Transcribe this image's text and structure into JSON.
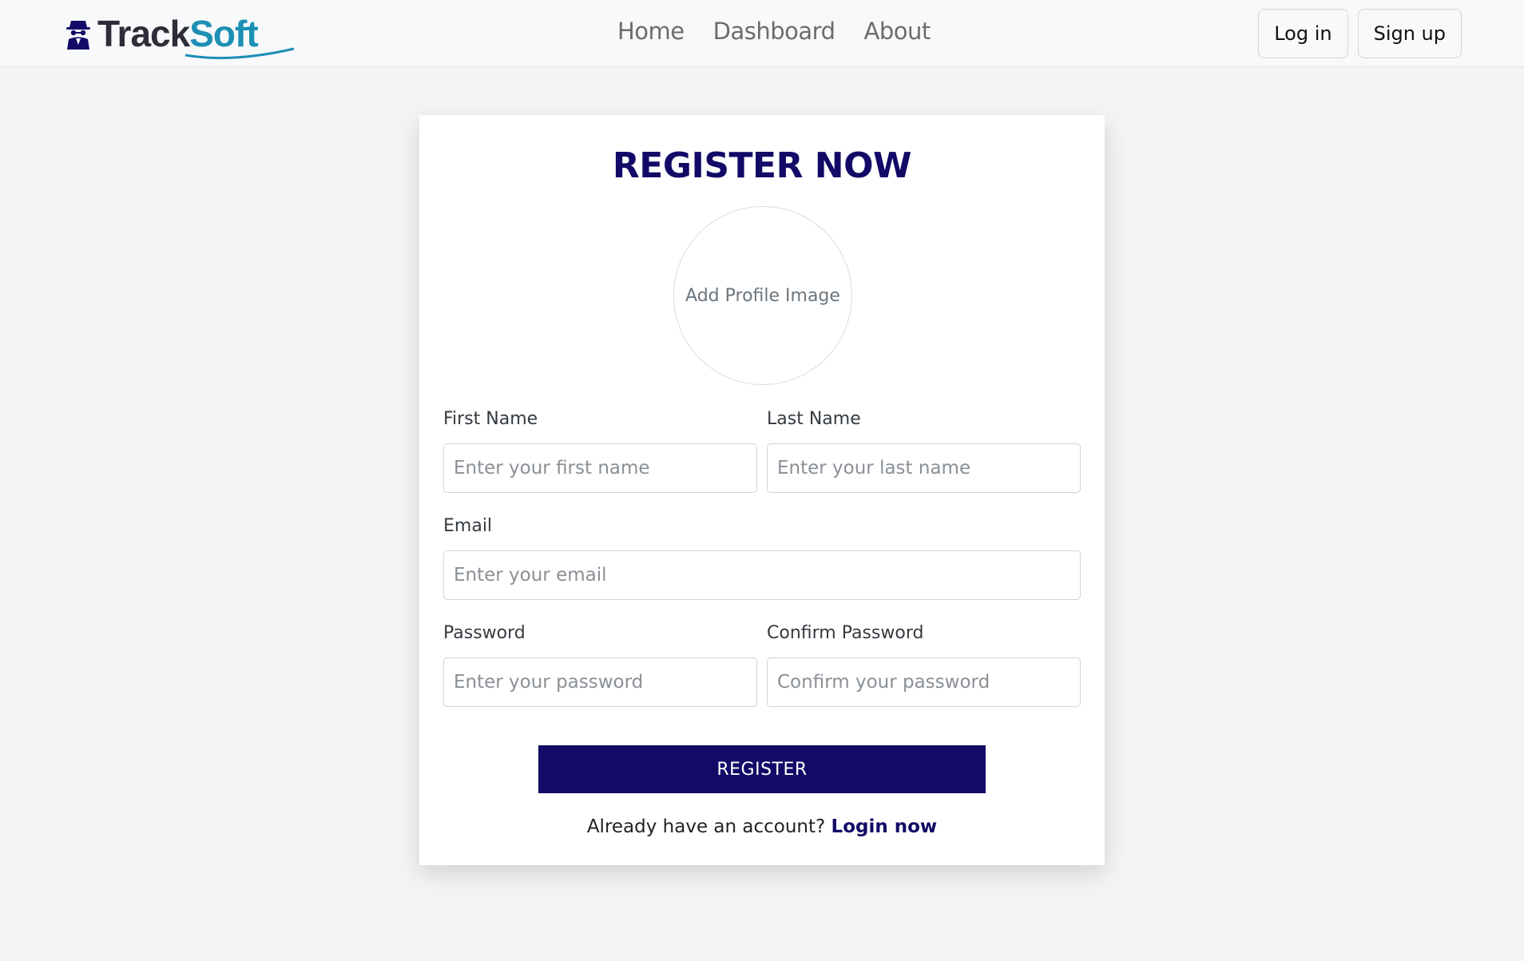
{
  "brand": {
    "icon": "spy-icon",
    "name_part1": "Track",
    "name_part2": "Soft"
  },
  "nav": {
    "links": [
      {
        "label": "Home"
      },
      {
        "label": "Dashboard"
      },
      {
        "label": "About"
      }
    ],
    "login_label": "Log in",
    "signup_label": "Sign up"
  },
  "form": {
    "title": "REGISTER NOW",
    "profile_image_label": "Add Profile Image",
    "first_name": {
      "label": "First Name",
      "placeholder": "Enter your first name",
      "value": ""
    },
    "last_name": {
      "label": "Last Name",
      "placeholder": "Enter your last name",
      "value": ""
    },
    "email": {
      "label": "Email",
      "placeholder": "Enter your email",
      "value": ""
    },
    "password": {
      "label": "Password",
      "placeholder": "Enter your password",
      "value": ""
    },
    "confirm_password": {
      "label": "Confirm Password",
      "placeholder": "Confirm your password",
      "value": ""
    },
    "submit_label": "REGISTER",
    "login_prompt": "Already have an account?",
    "login_link": "Login now"
  },
  "colors": {
    "primary": "#120a66",
    "brand_dark": "#2d2d3a",
    "brand_accent": "#1c8fb5",
    "page_bg": "#f4f4f4",
    "navbar_bg": "#f8f9fa"
  }
}
